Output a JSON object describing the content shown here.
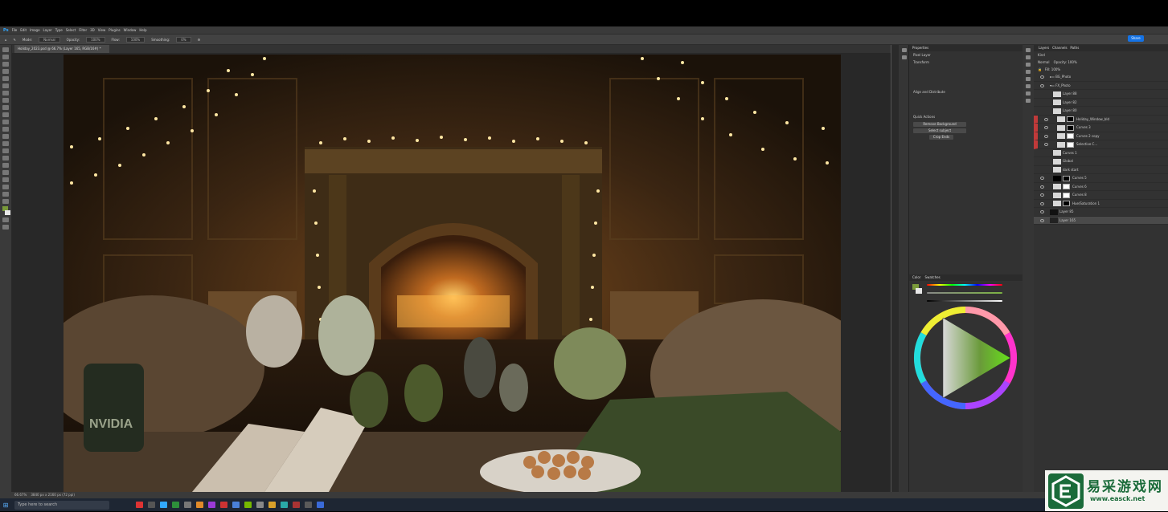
{
  "menubar": {
    "logo": "Ps",
    "items": [
      "File",
      "Edit",
      "Image",
      "Layer",
      "Type",
      "Select",
      "Filter",
      "3D",
      "View",
      "Plugins",
      "Window",
      "Help"
    ]
  },
  "options_bar": {
    "mode_label": "Mode:",
    "mode_value": "Normal",
    "opacity_label": "Opacity:",
    "opacity_value": "100%",
    "flow_label": "Flow:",
    "flow_value": "100%",
    "smoothing_label": "Smoothing:",
    "smoothing_value": "0%",
    "share_label": "Share"
  },
  "document_tab": {
    "title": "Holiday_2023.psd @ 66.7% (Layer 165, RGB/16#) *"
  },
  "properties": {
    "tabs": [
      "Properties"
    ],
    "pixel_layer": "Pixel Layer",
    "transform_label": "Transform",
    "align_label": "Align and Distribute",
    "quick_actions_label": "Quick Actions",
    "buttons": [
      "Remove Background",
      "Select subject",
      "Crop Ends"
    ]
  },
  "color_panel": {
    "tabs": [
      "Color",
      "Swatches"
    ],
    "fg_color": "#7a9a3a",
    "bg_color": "#e8e8e8"
  },
  "layers_panel": {
    "tabs": [
      "Layers",
      "Channels",
      "Paths"
    ],
    "filter_label": "Kind",
    "blend_mode": "Normal",
    "opacity_label": "Opacity:",
    "opacity_value": "100%",
    "fill_label": "Fill:",
    "fill_value": "100%",
    "layers": [
      {
        "name": "BG_Photo",
        "type": "group"
      },
      {
        "name": "FX_Photo",
        "type": "group"
      },
      {
        "name": "Layer 88",
        "type": "pixel"
      },
      {
        "name": "Layer 82",
        "type": "pixel"
      },
      {
        "name": "Layer 80",
        "type": "pixel"
      },
      {
        "name": "Holiday_Window_bld",
        "type": "adjust"
      },
      {
        "name": "Curves 3",
        "type": "adjust"
      },
      {
        "name": "Curves 2 copy",
        "type": "adjust"
      },
      {
        "name": "Selective C...",
        "type": "adjust"
      },
      {
        "name": "Curves 1",
        "type": "pixel"
      },
      {
        "name": "Global",
        "type": "pixel"
      },
      {
        "name": "dark start",
        "type": "pixel"
      },
      {
        "name": "Curves 5",
        "type": "adjust"
      },
      {
        "name": "Curves 6",
        "type": "adjust"
      },
      {
        "name": "Curves 8",
        "type": "adjust"
      },
      {
        "name": "Hue/Saturation 1",
        "type": "adjust"
      },
      {
        "name": "Layer 85",
        "type": "pixel"
      },
      {
        "name": "Layer 165",
        "type": "pixel"
      }
    ]
  },
  "status": {
    "zoom": "66.67%",
    "doc_size": "3840 px x 2160 px (72 ppi)"
  },
  "taskbar": {
    "search_placeholder": "Type here to search"
  },
  "watermark": {
    "title": "易采游戏网",
    "url": "www.easck.net"
  },
  "canvas_text": {
    "mug_logo": "NVIDIA"
  }
}
